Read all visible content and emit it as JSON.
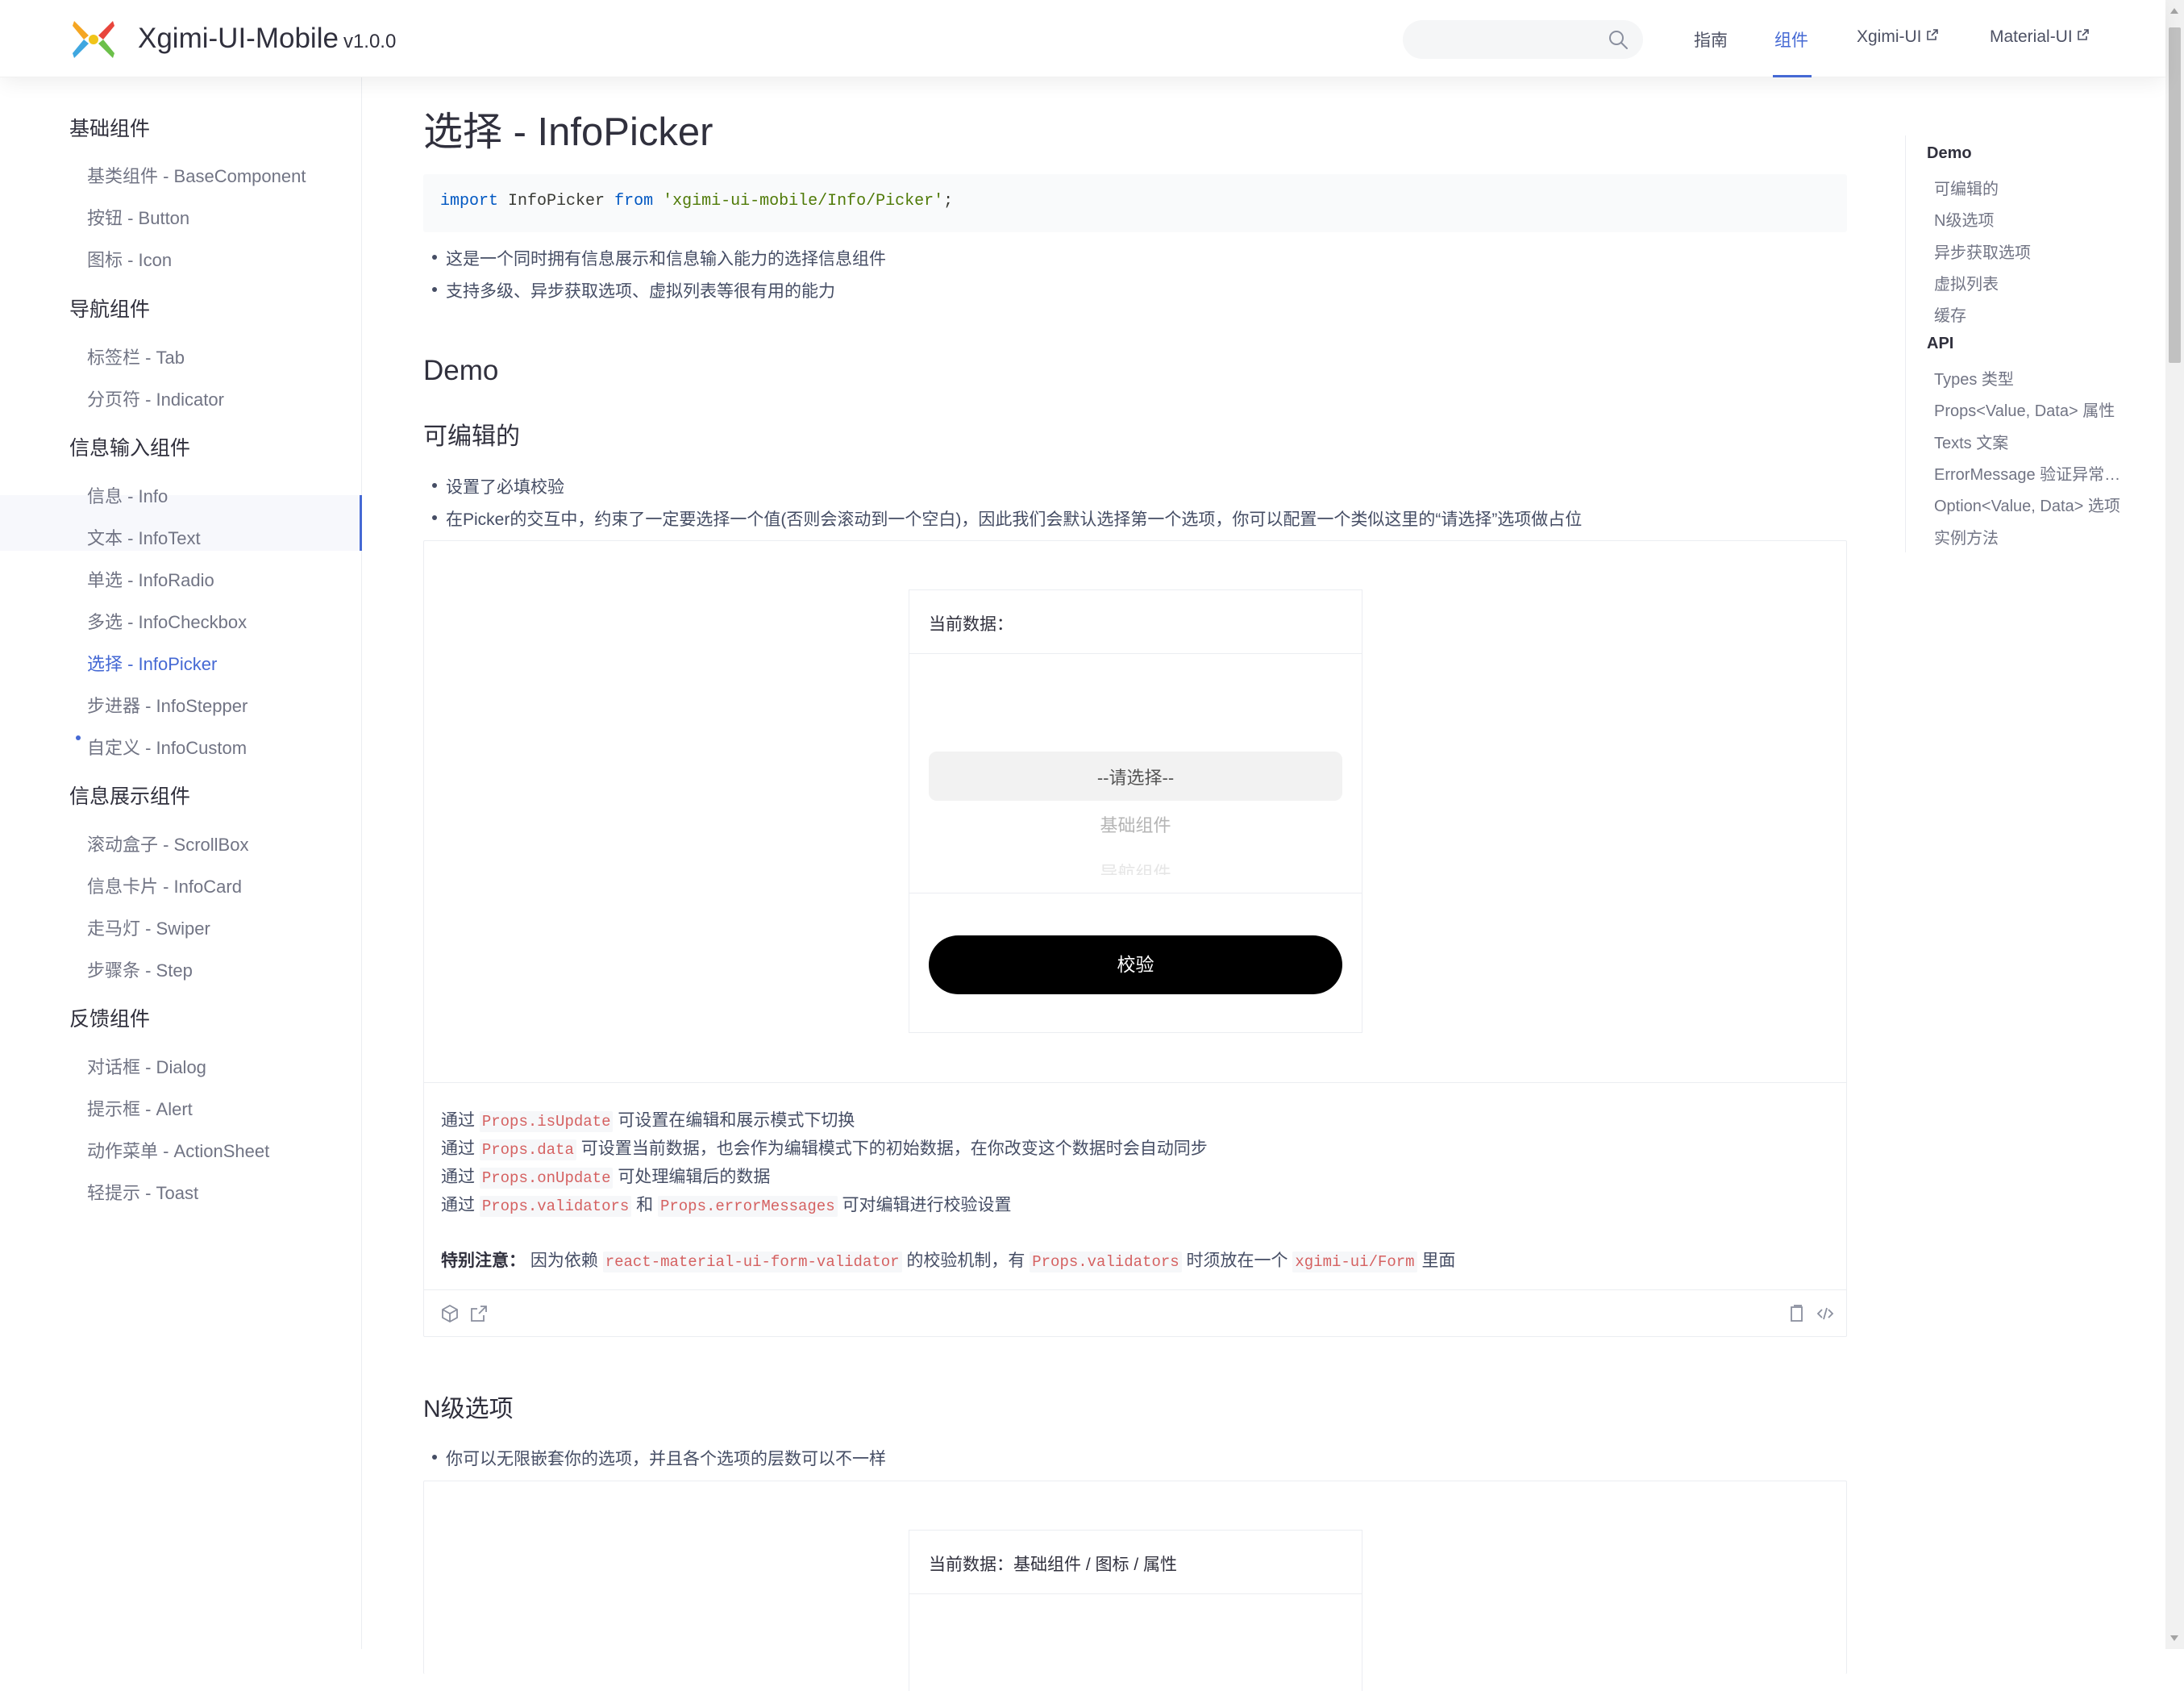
{
  "header": {
    "title": "Xgimi-UI-Mobile",
    "version": "v1.0.0",
    "search_placeholder": "",
    "nav": [
      {
        "label": "指南"
      },
      {
        "label": "组件"
      },
      {
        "label": "Xgimi-UI"
      },
      {
        "label": "Material-UI"
      }
    ]
  },
  "sidebar": {
    "groups": [
      {
        "label": "基础组件",
        "items": [
          "基类组件 - BaseComponent",
          "按钮 - Button",
          "图标 - Icon"
        ]
      },
      {
        "label": "导航组件",
        "items": [
          "标签栏 - Tab",
          "分页符 - Indicator"
        ]
      },
      {
        "label": "信息输入组件",
        "items": [
          "信息 - Info",
          "文本 - InfoText",
          "单选 - InfoRadio",
          "多选 - InfoCheckbox",
          "选择 - InfoPicker",
          "步进器 - InfoStepper",
          "自定义 - InfoCustom"
        ]
      },
      {
        "label": "信息展示组件",
        "items": [
          "滚动盒子 - ScrollBox",
          "信息卡片 - InfoCard",
          "走马灯 - Swiper",
          "步骤条 - Step"
        ]
      },
      {
        "label": "反馈组件",
        "items": [
          "对话框 - Dialog",
          "提示框 - Alert",
          "动作菜单 - ActionSheet",
          "轻提示 - Toast"
        ]
      }
    ]
  },
  "main": {
    "title": "选择 - InfoPicker",
    "import_code": {
      "kw1": "import",
      "name": "InfoPicker",
      "kw2": "from",
      "path": "'xgimi-ui-mobile/Info/Picker'",
      "semi": ";"
    },
    "intro": [
      "这是一个同时拥有信息展示和信息输入能力的选择信息组件",
      "支持多级、异步获取选项、虚拟列表等很有用的能力"
    ],
    "demo_heading": "Demo",
    "section1": {
      "title": "可编辑的",
      "bullets": [
        "设置了必填校验",
        "在Picker的交互中，约束了一定要选择一个值(否则会滚动到一个空白)，因此我们会默认选择第一个选项，你可以配置一个类似这里的“请选择”选项做占位"
      ],
      "current_data_label": "当前数据：",
      "current_data_value": "",
      "picker_options": [
        "--请选择--",
        "基础组件",
        "导航组件"
      ],
      "verify_button": "校验",
      "desc": {
        "l1_pre": "通过",
        "l1_code": "Props.isUpdate",
        "l1_post": "可设置在编辑和展示模式下切换",
        "l2_pre": "通过",
        "l2_code": "Props.data",
        "l2_post": "可设置当前数据，也会作为编辑模式下的初始数据，在你改变这个数据时会自动同步",
        "l3_pre": "通过",
        "l3_code": "Props.onUpdate",
        "l3_post": "可处理编辑后的数据",
        "l4_pre": "通过",
        "l4_code": "Props.validators",
        "l4_mid": "和",
        "l4_code2": "Props.errorMessages",
        "l4_post": "可对编辑进行校验设置",
        "note_label": "特别注意：",
        "note_pre": "因为依赖",
        "note_code1": "react-material-ui-form-validator",
        "note_mid": "的校验机制，有",
        "note_code2": "Props.validators",
        "note_mid2": "时须放在一个",
        "note_code3": "xgimi-ui/Form",
        "note_post": "里面"
      }
    },
    "section2": {
      "title": "N级选项",
      "bullets": [
        "你可以无限嵌套你的选项，并且各个选项的层数可以不一样"
      ],
      "current_data_label": "当前数据：",
      "current_data_value": "基础组件 / 图标 / 属性"
    }
  },
  "toc": {
    "items": [
      {
        "label": "Demo",
        "level": 1
      },
      {
        "label": "可编辑的",
        "level": 2
      },
      {
        "label": "N级选项",
        "level": 2
      },
      {
        "label": "异步获取选项",
        "level": 2
      },
      {
        "label": "虚拟列表",
        "level": 2
      },
      {
        "label": "缓存",
        "level": 2
      },
      {
        "label": "API",
        "level": 1
      },
      {
        "label": "Types 类型",
        "level": 2
      },
      {
        "label": "Props<Value, Data> 属性",
        "level": 2
      },
      {
        "label": "Texts 文案",
        "level": 2
      },
      {
        "label": "ErrorMessage 验证异常文…",
        "level": 2
      },
      {
        "label": "Option<Value, Data> 选项",
        "level": 2
      },
      {
        "label": "实例方法",
        "level": 2
      }
    ]
  },
  "colors": {
    "accent": "#4569d4",
    "code_red": "#d56161",
    "button_bg": "#000000"
  }
}
